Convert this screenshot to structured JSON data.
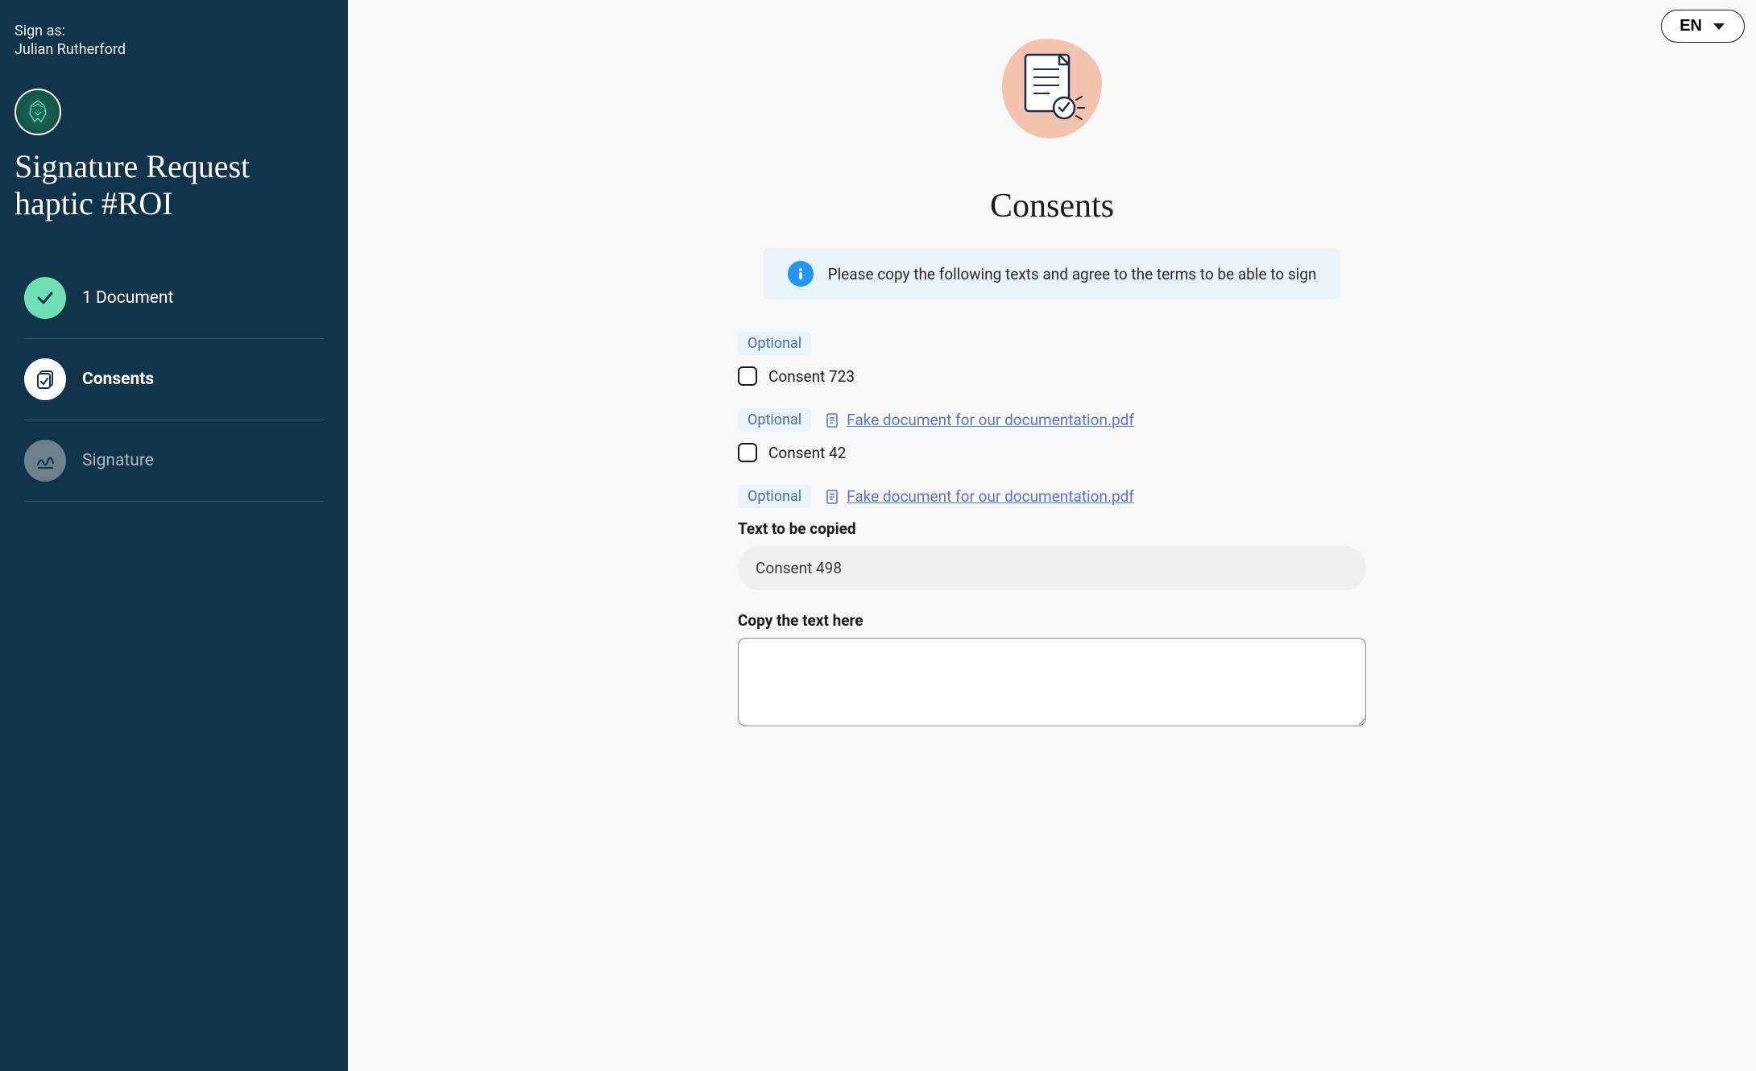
{
  "sidebar": {
    "sign_as_label": "Sign as:",
    "signer_name": "Julian Rutherford",
    "request_title": "Signature Request haptic #ROI",
    "steps": [
      {
        "label": "1 Document"
      },
      {
        "label": "Consents"
      },
      {
        "label": "Signature"
      }
    ]
  },
  "header": {
    "language_code": "EN"
  },
  "main": {
    "page_title": "Consents",
    "info_text": "Please copy the following texts and agree to the terms to be able to sign",
    "optional_badge": "Optional",
    "consents": [
      {
        "label": "Consent 723",
        "doc": null
      },
      {
        "label": "Consent 42",
        "doc": "Fake document for our documentation.pdf"
      }
    ],
    "copy_block": {
      "doc": "Fake document for our documentation.pdf",
      "text_to_copy_label": "Text to be copied",
      "text_to_copy_value": "Consent 498",
      "copy_here_label": "Copy the text here"
    }
  }
}
